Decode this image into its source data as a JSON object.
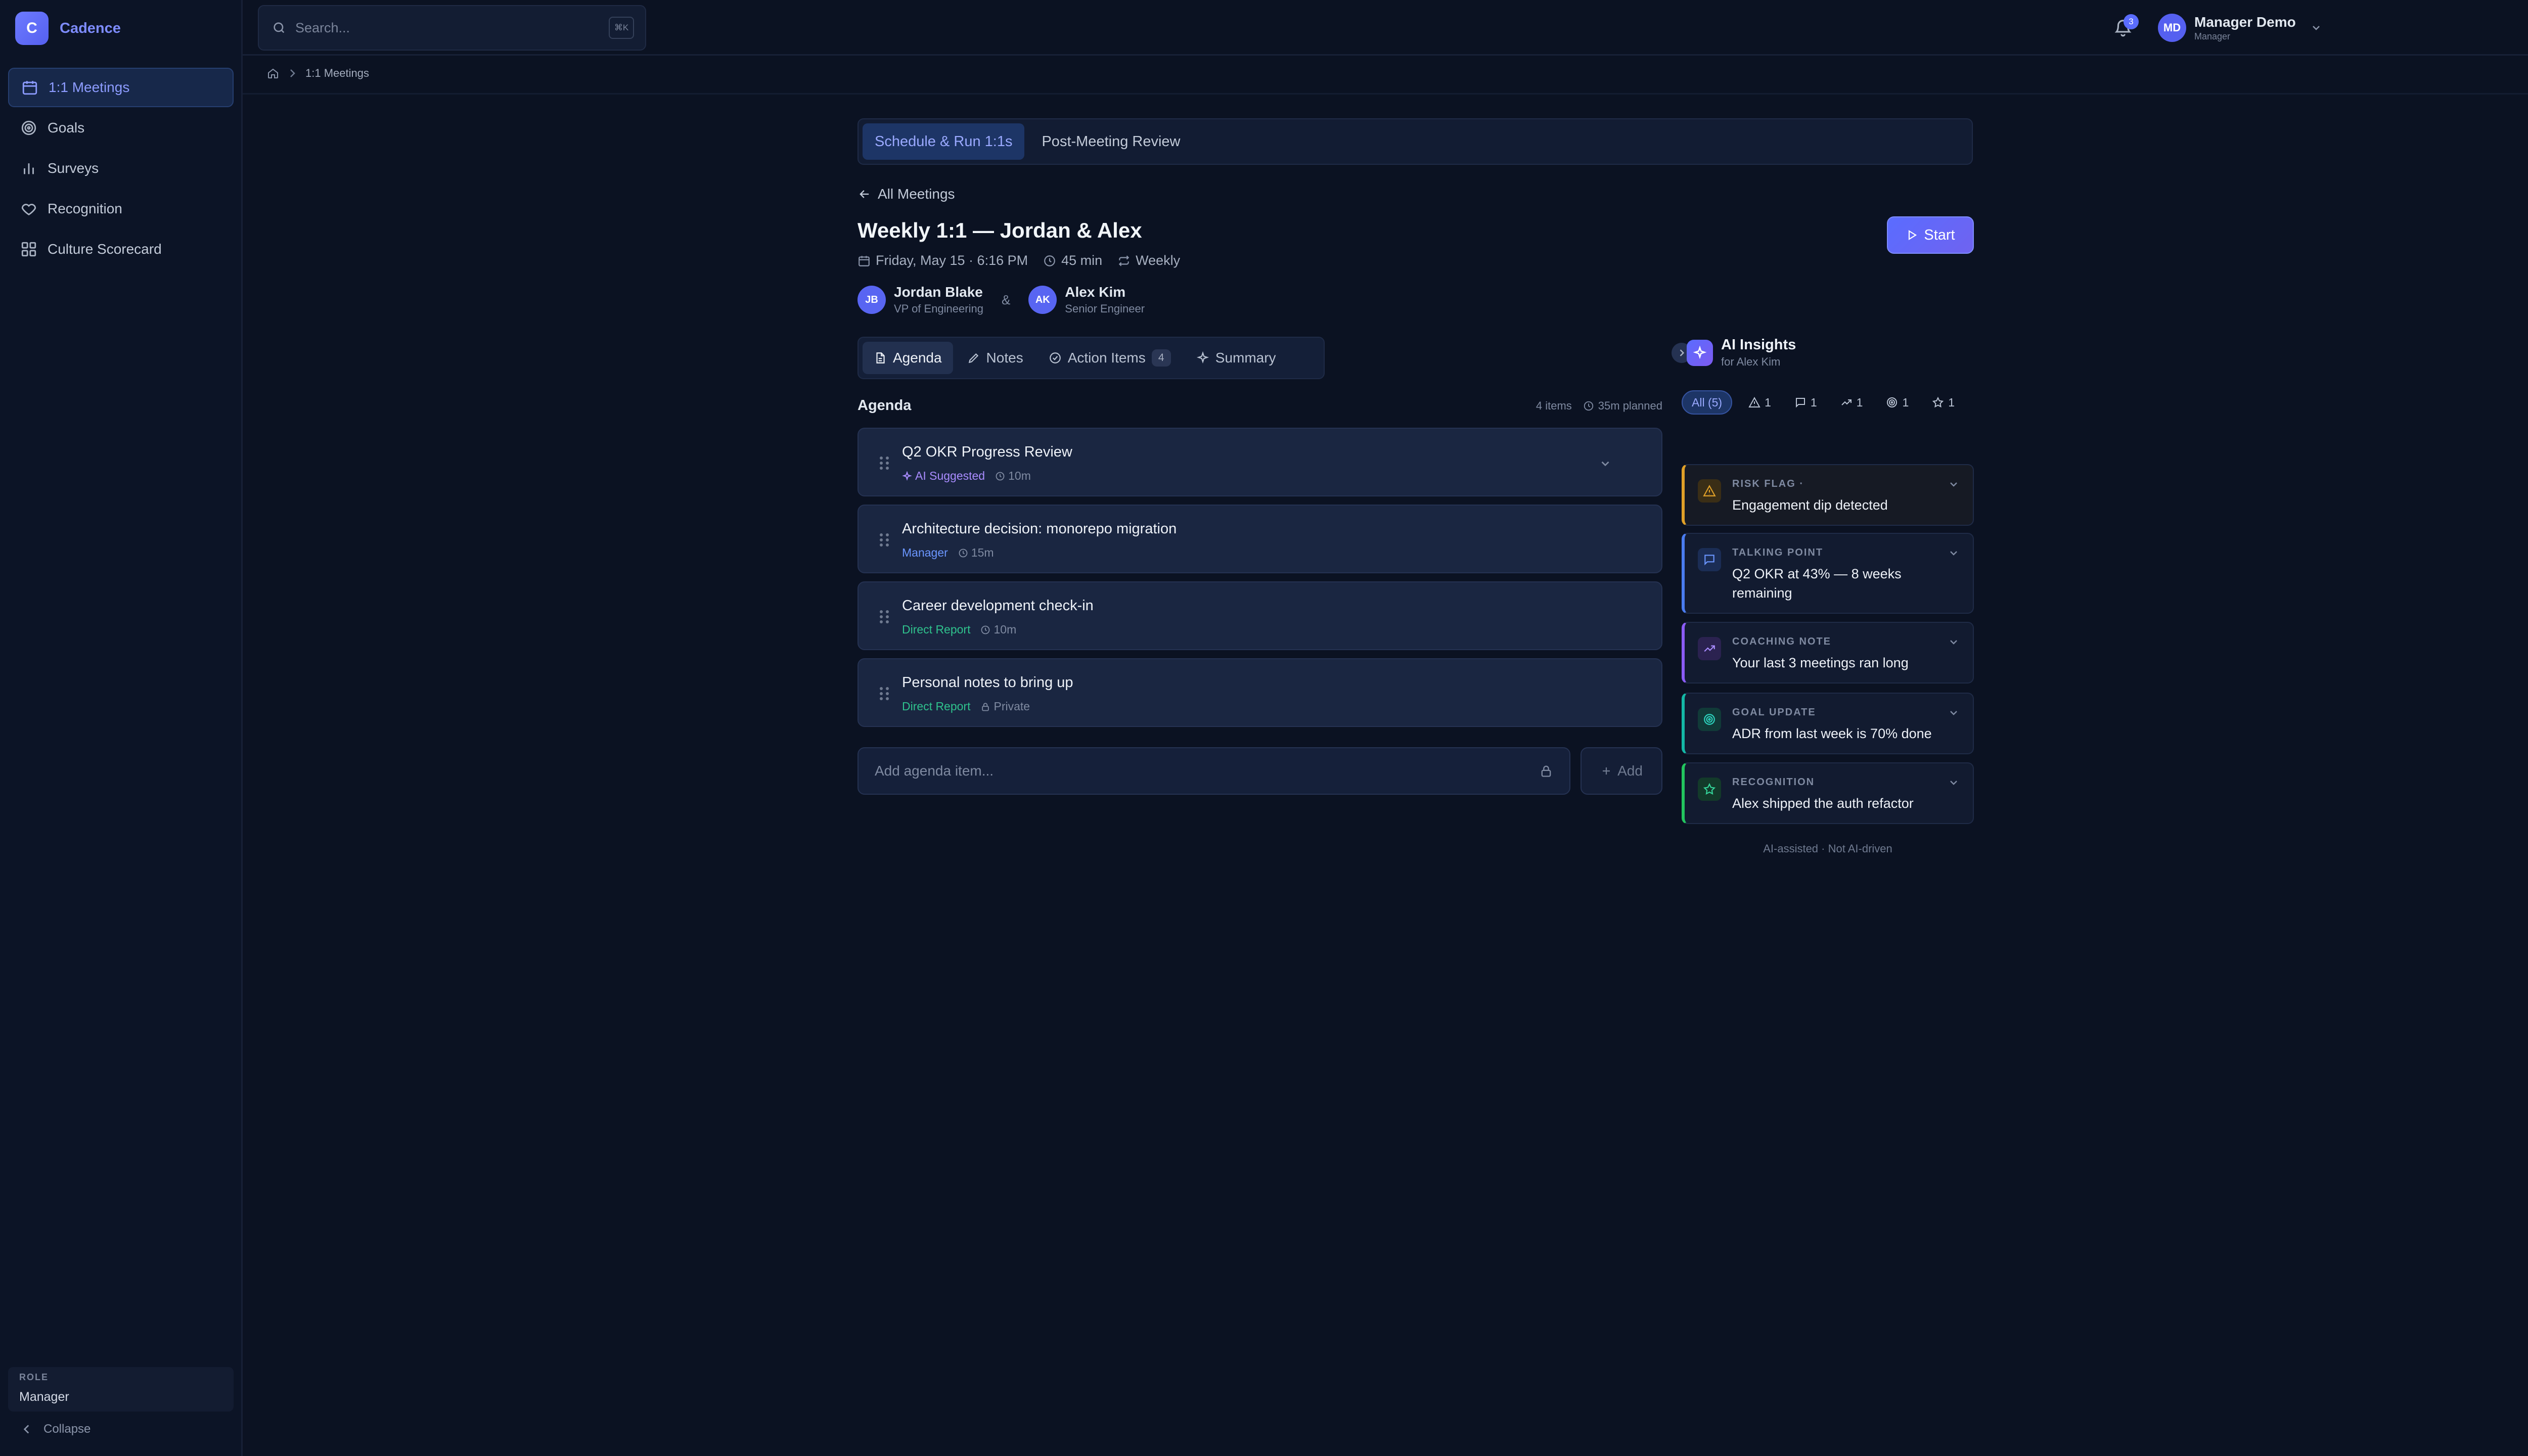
{
  "brand": {
    "logo_letter": "C",
    "name": "Cadence"
  },
  "sidebar": {
    "items": [
      {
        "label": "1:1 Meetings",
        "icon": "calendar-icon"
      },
      {
        "label": "Goals",
        "icon": "target-icon"
      },
      {
        "label": "Surveys",
        "icon": "bar-chart-icon"
      },
      {
        "label": "Recognition",
        "icon": "heart-icon"
      },
      {
        "label": "Culture Scorecard",
        "icon": "grid-icon"
      }
    ],
    "role_label": "ROLE",
    "role_value": "Manager",
    "collapse_label": "Collapse"
  },
  "topbar": {
    "search_placeholder": "Search...",
    "search_shortcut": "⌘K",
    "notification_count": "3",
    "user": {
      "initials": "MD",
      "name": "Manager Demo",
      "role": "Manager"
    }
  },
  "breadcrumb": {
    "current": "1:1 Meetings"
  },
  "page_tabs": [
    "Schedule & Run 1:1s",
    "Post-Meeting Review"
  ],
  "meeting": {
    "back_label": "All Meetings",
    "title": "Weekly 1:1 — Jordan & Alex",
    "date": "Friday, May 15 · 6:16 PM",
    "duration": "45 min",
    "recurrence": "Weekly",
    "start_label": "Start",
    "amp": "&",
    "participants": [
      {
        "initials": "JB",
        "name": "Jordan Blake",
        "role": "VP of Engineering"
      },
      {
        "initials": "AK",
        "name": "Alex Kim",
        "role": "Senior Engineer"
      }
    ]
  },
  "sub_tabs": {
    "agenda": "Agenda",
    "notes": "Notes",
    "action_items": "Action Items",
    "action_items_count": "4",
    "summary": "Summary"
  },
  "agenda": {
    "title": "Agenda",
    "count_text": "4 items",
    "planned_text": "35m planned",
    "items": [
      {
        "title": "Q2 OKR Progress Review",
        "source": "AI Suggested",
        "duration": "10m"
      },
      {
        "title": "Architecture decision: monorepo migration",
        "source": "Manager",
        "duration": "15m"
      },
      {
        "title": "Career development check-in",
        "source": "Direct Report",
        "duration": "10m"
      },
      {
        "title": "Personal notes to bring up",
        "source": "Direct Report",
        "duration": "Private"
      }
    ],
    "add_placeholder": "Add agenda item...",
    "add_label": "Add"
  },
  "insights": {
    "title": "AI Insights",
    "subtitle": "for Alex Kim",
    "filters": {
      "all": "All (5)",
      "risk": "1",
      "talking": "1",
      "coaching": "1",
      "goal": "1",
      "recognition": "1"
    },
    "cards": [
      {
        "type": "RISK FLAG ·",
        "text": "Engagement dip detected",
        "color": "#e0a028"
      },
      {
        "type": "TALKING POINT",
        "text": "Q2 OKR at 43% — 8 weeks remaining",
        "color": "#4a7cf0"
      },
      {
        "type": "COACHING NOTE",
        "text": "Your last 3 meetings ran long",
        "color": "#8b5cf6"
      },
      {
        "type": "GOAL UPDATE",
        "text": "ADR from last week is 70% done",
        "color": "#14b8a6"
      },
      {
        "type": "RECOGNITION",
        "text": "Alex shipped the auth refactor",
        "color": "#22c55e"
      }
    ],
    "footnote": "AI-assisted · Not AI-driven"
  }
}
